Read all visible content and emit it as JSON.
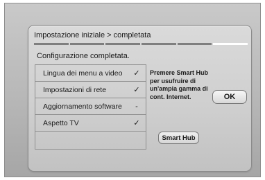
{
  "dialog": {
    "title": "Impostazione iniziale > completata",
    "progress": {
      "total_steps": 6,
      "current_step": 6
    },
    "subtitle": "Configurazione completata.",
    "items": [
      {
        "label": "Lingua dei menu a video",
        "status": "✓"
      },
      {
        "label": "Impostazioni di rete",
        "status": "✓"
      },
      {
        "label": "Aggiornamento software",
        "status": "-"
      },
      {
        "label": "Aspetto TV",
        "status": "✓"
      }
    ],
    "info_text": "Premere Smart Hub per usufruire di un'ampia gamma di cont. Internet.",
    "ok_label": "OK",
    "smart_hub_label": "Smart Hub"
  }
}
